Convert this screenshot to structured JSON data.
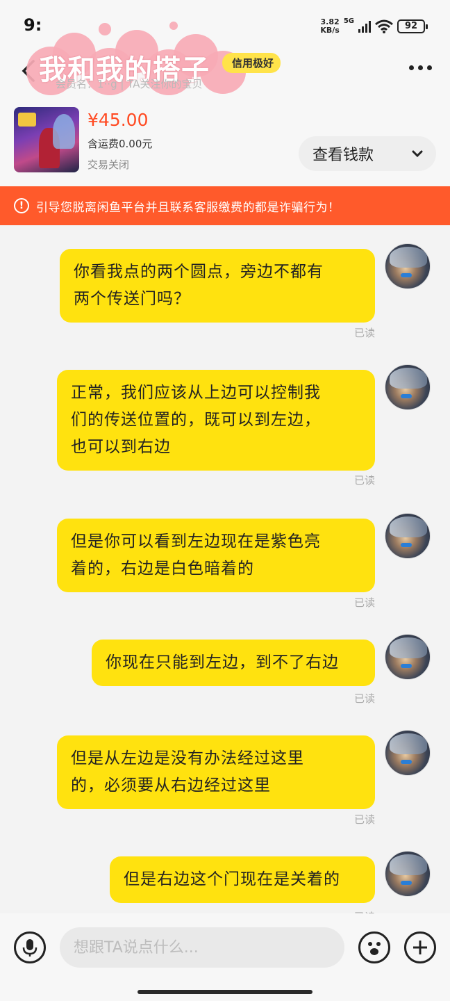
{
  "status": {
    "time": "9:",
    "net_speed": "3.82",
    "net_unit": "KB/s",
    "network": "5G",
    "battery": "92"
  },
  "header": {
    "title": "我和我的搭子",
    "credit_badge": "信用极好",
    "subtitle": "会员名：1··g | TA关注你的宝贝"
  },
  "product": {
    "price": "¥45.00",
    "shipping": "含运费0.00元",
    "status": "交易关闭",
    "view_payment_label": "查看钱款"
  },
  "warning": {
    "icon": "!",
    "text": "引导您脱离闲鱼平台并且联系客服缴费的都是诈骗行为！"
  },
  "messages": [
    {
      "lines": [
        "你看我点的两个圆点，旁边不都有",
        "两个传送门吗？"
      ],
      "read": "已读"
    },
    {
      "lines": [
        "正常，我们应该从上边可以控制我",
        "们的传送位置的，既可以到左边，",
        "也可以到右边"
      ],
      "read": "已读"
    },
    {
      "lines": [
        "但是你可以看到左边现在是紫色亮",
        "着的，右边是白色暗着的"
      ],
      "read": "已读"
    },
    {
      "lines": [
        "你现在只能到左边，到不了右边"
      ],
      "read": "已读"
    },
    {
      "lines": [
        "但是从左边是没有办法经过这里",
        "的，必须要从右边经过这里"
      ],
      "read": "已读"
    },
    {
      "lines": [
        "但是右边这个门现在是关着的"
      ],
      "read": "已读"
    }
  ],
  "input": {
    "placeholder": "想跟TA说点什么..."
  }
}
